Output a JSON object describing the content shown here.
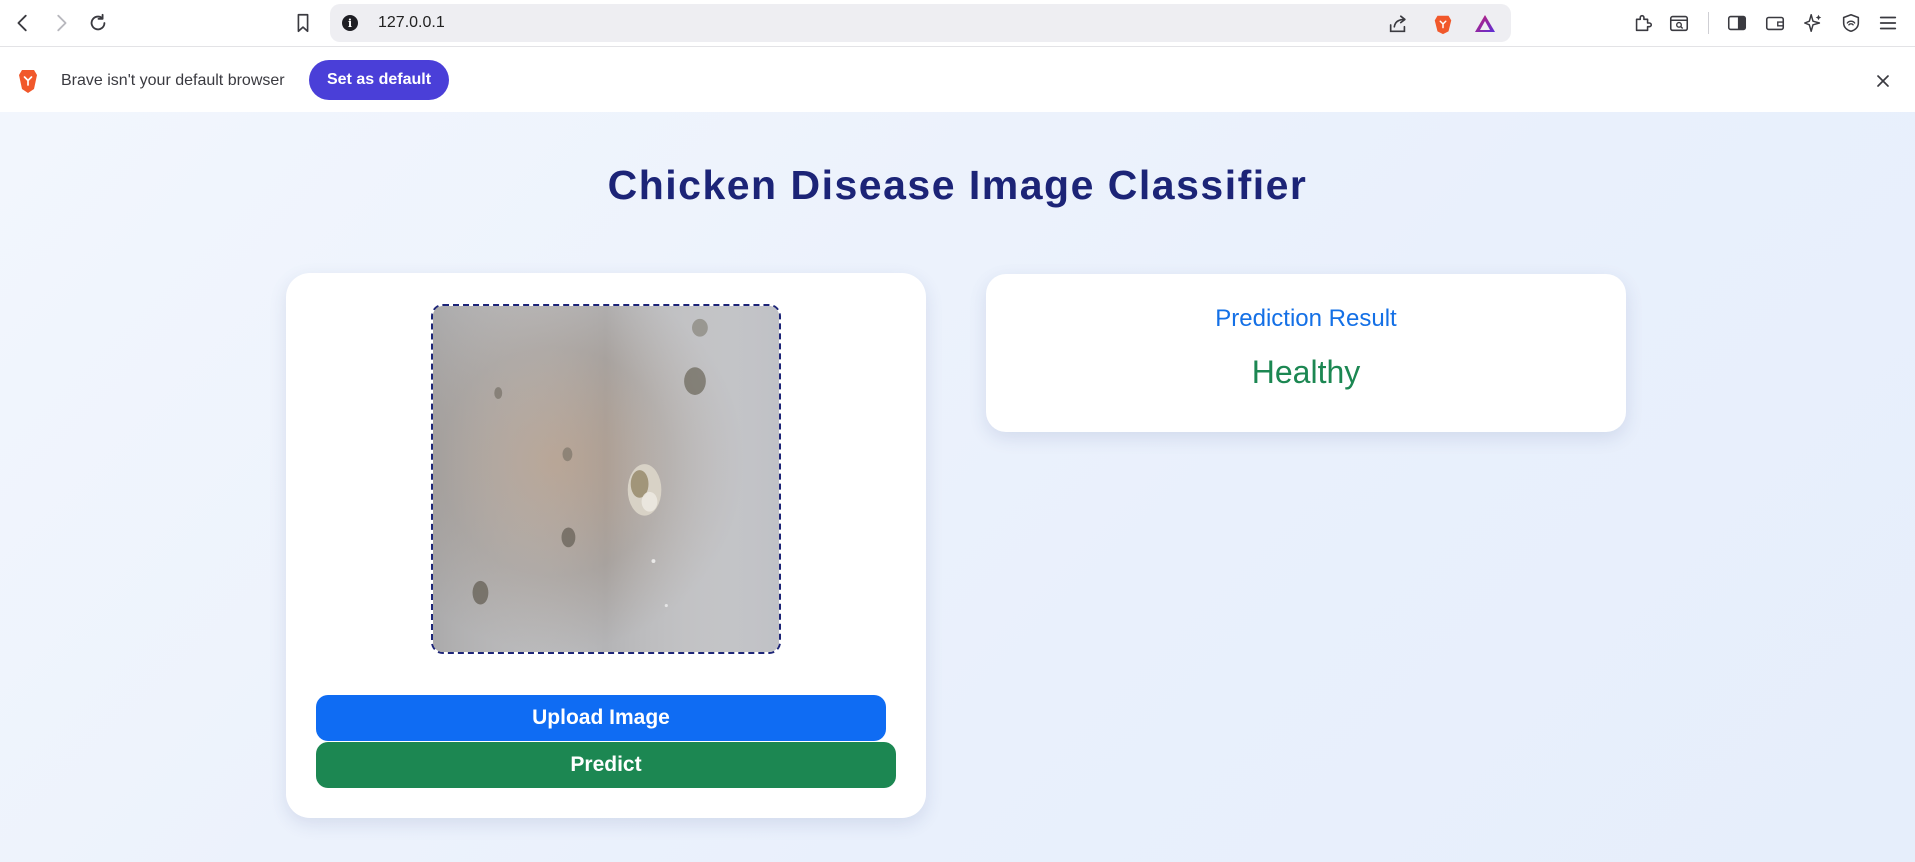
{
  "browser": {
    "url": "127.0.0.1",
    "icons": [
      "back-icon",
      "forward-icon",
      "reload-icon",
      "bookmark-icon",
      "site-info-icon",
      "share-icon",
      "brave-shields-icon",
      "brave-rewards-icon",
      "extensions-icon",
      "reading-list-icon",
      "sidebar-icon",
      "wallet-icon",
      "leo-ai-icon",
      "vpn-icon",
      "menu-icon"
    ]
  },
  "infobar": {
    "message": "Brave isn't your default browser",
    "button_label": "Set as default",
    "accent_color": "#4a3fd8"
  },
  "page": {
    "title": "Chicken Disease Image Classifier",
    "upload_button": "Upload Image",
    "predict_button": "Predict",
    "result": {
      "heading": "Prediction Result",
      "value": "Healthy"
    },
    "colors": {
      "title": "#1c2477",
      "upload": "#0f6cf3",
      "predict": "#1c8752",
      "result_heading": "#1470e6",
      "result_value": "#1c8752"
    }
  }
}
